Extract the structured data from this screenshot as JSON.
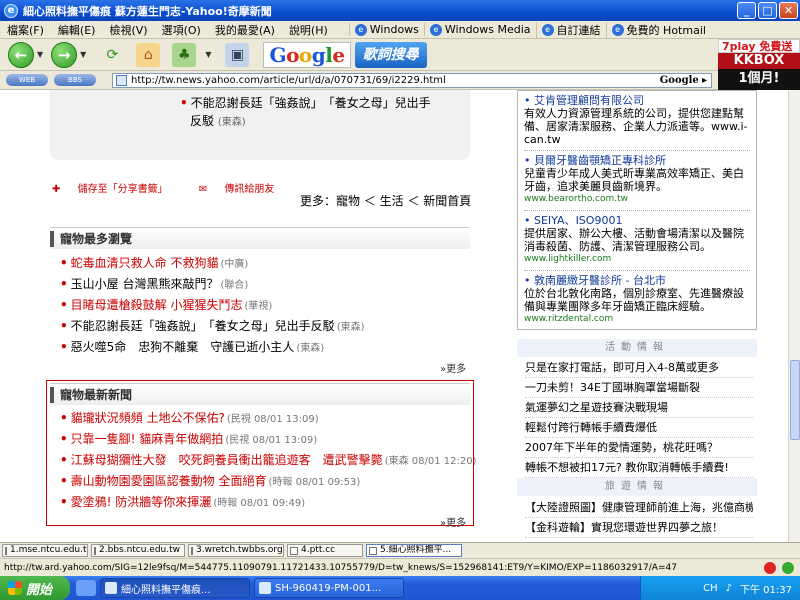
{
  "window": {
    "title": "細心照料撫平傷痕 蘇方蓮生門志-Yahoo!奇摩新聞"
  },
  "menu": {
    "items": [
      "檔案(F)",
      "編輯(E)",
      "檢視(V)",
      "選項(O)",
      "我的最愛(A)",
      "說明(H)"
    ],
    "links": [
      "Windows",
      "Windows Media",
      "自訂連結",
      "免費的 Hotmail"
    ]
  },
  "toolbar": {
    "google_letters": [
      "G",
      "o",
      "o",
      "g",
      "l",
      "e"
    ],
    "lyric_search": "歌詞搜尋"
  },
  "kkbox_ad": {
    "top": "7play 免費送",
    "mid": "KKBOX",
    "bot": "1個月!"
  },
  "address": {
    "mini_btn_1": "WEB",
    "mini_btn_2": "BBS",
    "url": "http://tw.news.yahoo.com/article/url/d/a/070731/69/i2229.html",
    "search_label": "Google"
  },
  "content": {
    "top_item": {
      "text": "不能忍謝長廷「強姦說」　「養女之母」兒出手",
      "text2": "反駁",
      "src": "(東森)"
    },
    "share": {
      "save": "儲存至「分享書籤」",
      "send": "傳訊給朋友"
    },
    "more_nav": "更多：寵物 ＜ 生活 ＜ 新聞首頁",
    "popular": {
      "title": "寵物最多瀏覽",
      "items": [
        {
          "text": "蛇毒血清只救人命 不救狗貓",
          "src": "(中廣)",
          "red": true
        },
        {
          "text": "玉山小屋 台灣黑熊來敲門？",
          "src": "(聯合)",
          "red": false
        },
        {
          "text": "目睹母遭槍殺鼓解 小猩猩失鬥志",
          "src": "(華視)",
          "red": true
        },
        {
          "text": "不能忍謝長廷「強姦說」　「養女之母」兒出手反駁",
          "src": "(東森)",
          "red": false
        },
        {
          "text": "惡火噬5命　忠狗不離棄　守護已逝小主人",
          "src": "(東森)",
          "red": false
        }
      ],
      "more": "»更多"
    },
    "latest": {
      "title": "寵物最新新聞",
      "items": [
        {
          "text": "貓瓏狀況頻頻 土地公不保佑?",
          "src": "(民視 08/01 13:09)"
        },
        {
          "text": "只靠一隻腳! 貓麻青年做網拍",
          "src": "(民視 08/01 13:09)"
        },
        {
          "text": "江蘇母猢獼性大發　咬死飼養員衝出籠追遊客　遭武警擊斃",
          "src": "(東森 08/01 12:20)"
        },
        {
          "text": "壽山動物園愛園區認養動物 全面絕育",
          "src": "(時報 08/01 09:53)"
        },
        {
          "text": "愛塗鴉! 防洪牆等你來揮灑",
          "src": "(時報 08/01 09:49)"
        }
      ],
      "more": "»更多"
    },
    "ads": [
      {
        "h": "艾肯管理顧問有限公司",
        "d": "有效人力資源管理系統的公司，提供您建點幫備、居家清潔服務、企業人力派遣等。www.i-can.tw",
        "u": ""
      },
      {
        "h": "貝爾牙醫齒顎矯正專科診所",
        "d": "兒童青少年成人美式昕專業高效率矯正、美白牙齒，追求美麗貝齒新境界。",
        "u": "www.bearortho.com.tw"
      },
      {
        "h": "SEIYA、ISO9001",
        "d": "提供居家、辦公大樓、活動會場清潔以及醫院消毒殺菌、防護、清潔管理服務公司。",
        "u": "www.lightkiller.com"
      },
      {
        "h": "敦南麗緻牙醫診所 - 台北市",
        "d": "位於台北敦化南路，個別診療室、先進醫療設備與專業團隊多年牙齒矯正臨床經驗。",
        "u": "www.ritzdental.com"
      }
    ],
    "events": {
      "title": "活動情報",
      "items": [
        "只是在家打電話，即可月入4-8萬或更多",
        "一刀未剪！34E丁國琳胸罩當場斷裂",
        "氣運夢幻之星遊技賽決戰現場",
        "輕鬆付跨行轉帳手續費爆低",
        "2007年下半年的愛情運勢，桃花旺嗎？",
        "轉帳不想被扣17元? 教你取消轉帳手續費!"
      ]
    },
    "recommend": {
      "title": "旅遊情報",
      "items": [
        "【大陸證照圖】健康管理師前進上海，兆億商機",
        "【金科遊輪】實現您環遊世界四夢之旅！"
      ]
    }
  },
  "tabs": [
    "1.mse.ntcu.edu.tw",
    "2.bbs.ntcu.edu.tw",
    "3.wretch.twbbs.org",
    "4.ptt.cc",
    "5.細心照料撫平..."
  ],
  "status": {
    "text": "http://tw.ard.yahoo.com/SIG=12le9fsq/M=544775.11090791.11721433.10755779/D=tw_knews/S=152968141:ET9/Y=KIMO/EXP=1186032917/A=47"
  },
  "taskbar": {
    "start": "開始",
    "buttons": [
      "細心照料撫平傷痕...",
      "SH-960419-PM-001..."
    ],
    "tray_lang": "CH",
    "clock": "下午 01:37"
  }
}
